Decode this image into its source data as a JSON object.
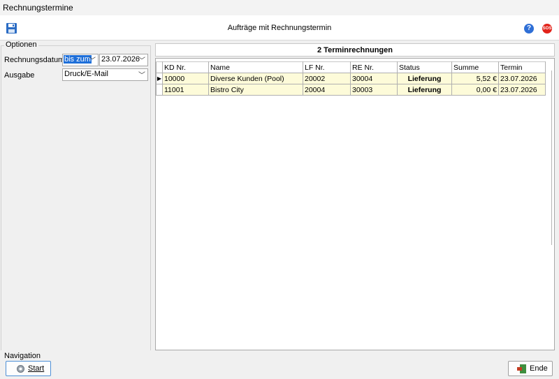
{
  "window": {
    "title": "Rechnungstermine"
  },
  "toolbar": {
    "title": "Aufträge mit Rechnungstermin",
    "help_icon": "help-icon",
    "sos_label": "SOS"
  },
  "options": {
    "title": "Optionen",
    "rechnungsdatum_label": "Rechnungsdatum",
    "mode_value": "bis zum",
    "date_value": "23.07.2026",
    "ausgabe_label": "Ausgabe",
    "ausgabe_value": "Druck/E-Mail"
  },
  "grid": {
    "title": "2 Terminrechnungen",
    "columns": [
      "KD Nr.",
      "Name",
      "LF Nr.",
      "RE Nr.",
      "Status",
      "Summe",
      "Termin"
    ],
    "rows": [
      {
        "kd": "10000",
        "name": "Diverse Kunden (Pool)",
        "lf": "20002",
        "re": "30004",
        "status": "Lieferung",
        "summe": "5,52 €",
        "termin": "23.07.2026"
      },
      {
        "kd": "11001",
        "name": "Bistro City",
        "lf": "20004",
        "re": "30003",
        "status": "Lieferung",
        "summe": "0,00 €",
        "termin": "23.07.2026"
      }
    ]
  },
  "navigation": {
    "title": "Navigation",
    "start_label": "Start",
    "ende_label": "Ende"
  }
}
